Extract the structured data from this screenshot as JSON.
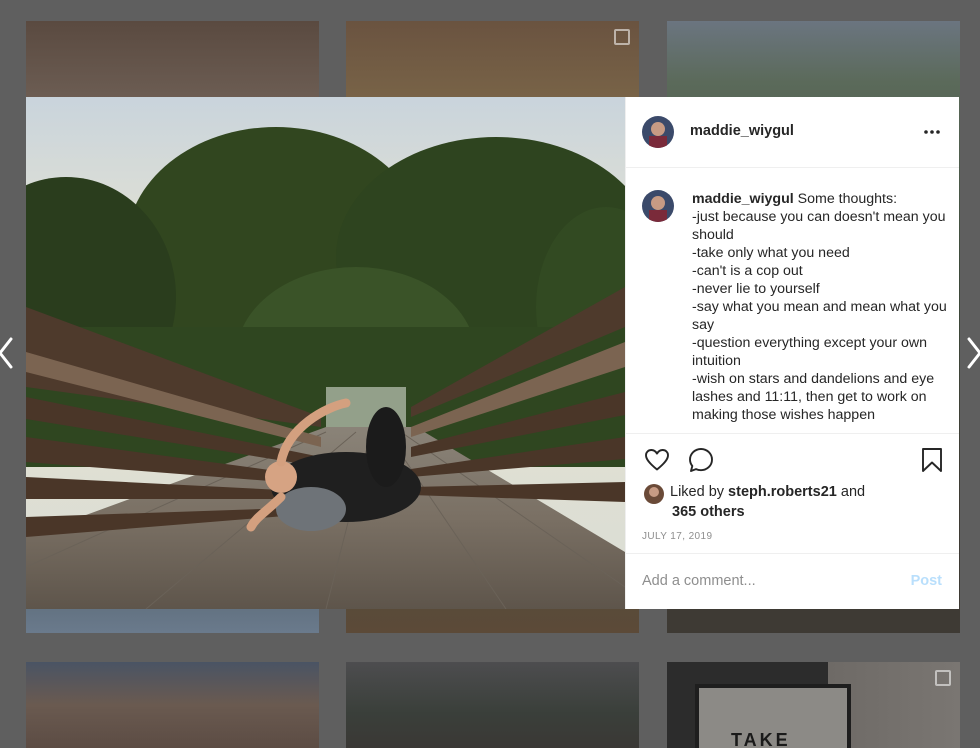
{
  "post": {
    "username": "maddie_wiygul",
    "caption_lines": [
      "Some thoughts:",
      "-just because you can doesn't mean you should",
      "-take only what you need",
      "-can't is a cop out",
      "-never lie to yourself",
      "-say what you mean and mean what you say",
      "-question everything except your own intuition",
      "-wish on stars and dandelions and eye lashes and 11:11, then get to work on making those wishes happen"
    ],
    "likes": {
      "prefix": "Liked by",
      "user": "steph.roberts21",
      "joiner": "and",
      "others": "365 others"
    },
    "date": "JULY 17, 2019",
    "comment": {
      "placeholder": "Add a comment...",
      "post_label": "Post"
    }
  },
  "background_tiles": {
    "sign_text": "TAKE"
  },
  "icons": {
    "more": "more-options-icon",
    "like": "heart-icon",
    "comment": "comment-bubble-icon",
    "save": "bookmark-icon",
    "prev": "chevron-left-icon",
    "next": "chevron-right-icon",
    "multi": "multiple-photos-icon"
  },
  "colors": {
    "text": "#262626",
    "muted": "#8e8e8e",
    "post_disabled": "#b9dffc",
    "divider": "#efefef",
    "backdrop": "#5f5f5f"
  }
}
